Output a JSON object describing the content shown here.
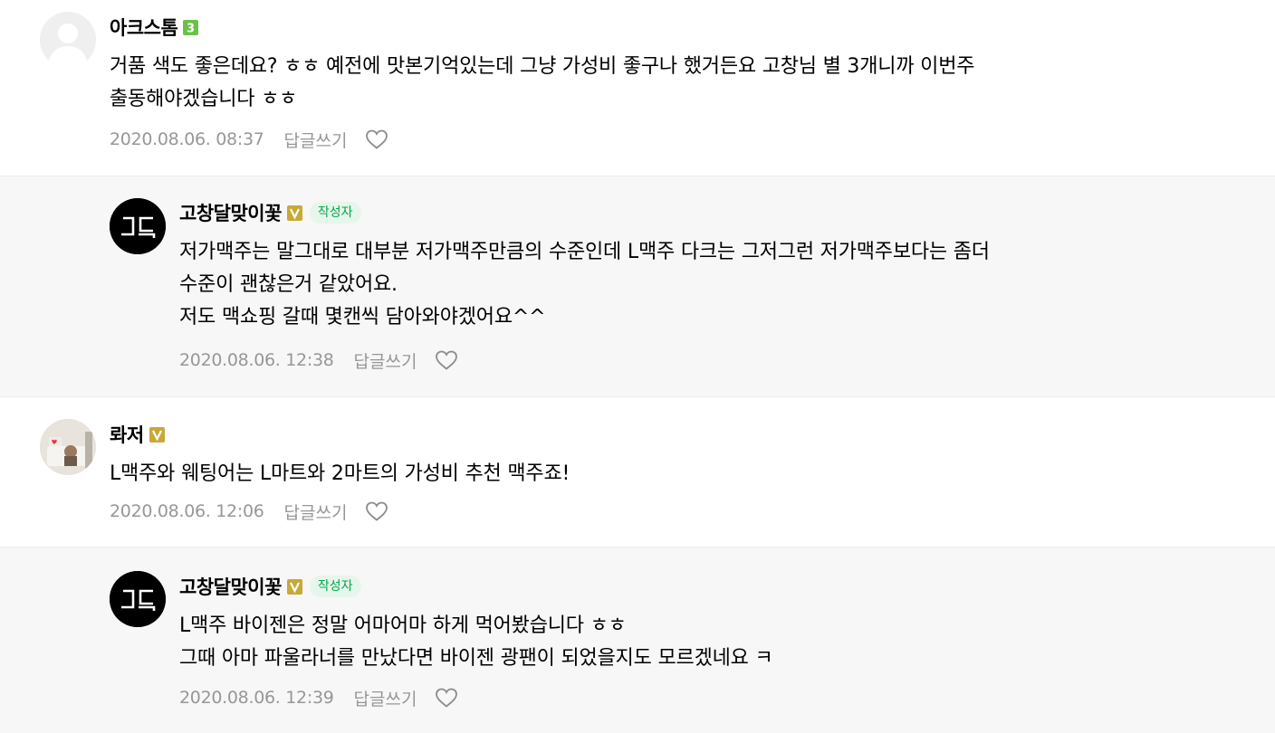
{
  "comments": [
    {
      "nickname": "아크스톰",
      "level": "3",
      "lines": [
        "거품 색도 좋은데요? ㅎㅎ 예전에 맛본기억있는데 그냥 가성비 좋구나 했거든요 고창님 별 3개니까 이번주",
        "출동해야겠습니다 ㅎㅎ"
      ],
      "date": "2020.08.06. 08:37",
      "reply_label": "답글쓰기"
    },
    {
      "nickname": "고창달맞이꽃",
      "avatar_text": "그담",
      "author_tag": "작성자",
      "lines": [
        "저가맥주는 말그대로 대부분 저가맥주만큼의 수준인데 L맥주 다크는 그저그런 저가맥주보다는 좀더",
        "수준이 괜찮은거 같았어요.",
        "저도 맥쇼핑 갈때 몇캔씩 담아와야겠어요^^"
      ],
      "date": "2020.08.06. 12:38",
      "reply_label": "답글쓰기"
    },
    {
      "nickname": "롸저",
      "lines": [
        "L맥주와 웨팅어는 L마트와 2마트의 가성비 추천 맥주죠!"
      ],
      "date": "2020.08.06. 12:06",
      "reply_label": "답글쓰기"
    },
    {
      "nickname": "고창달맞이꽃",
      "avatar_text": "그담",
      "author_tag": "작성자",
      "lines": [
        "L맥주 바이젠은 정말 어마어마 하게 먹어봤습니다 ㅎㅎ",
        "그때 아마 파울라너를 만났다면 바이젠 광팬이 되었을지도 모르겠네요 ㅋ"
      ],
      "date": "2020.08.06. 12:39",
      "reply_label": "답글쓰기"
    }
  ],
  "colors": {
    "level_badge": "#6cc04a",
    "verified_badge": "#c9a836",
    "author_tag_bg": "#e6f6ea",
    "author_tag_text": "#03a94d",
    "meta_text": "#979797",
    "reply_bg": "#f7f7f7"
  },
  "icons": {
    "like": "heart-outline-icon",
    "verified": "v-badge-icon",
    "level": "level-3-badge-icon",
    "default_avatar": "person-silhouette-icon"
  }
}
